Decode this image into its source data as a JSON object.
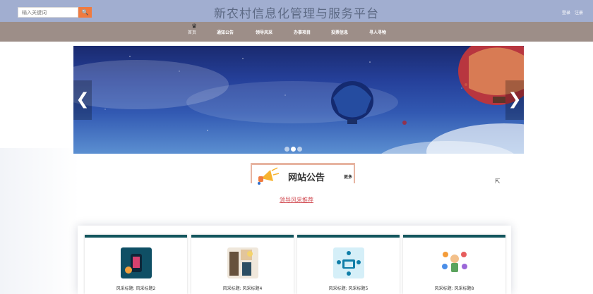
{
  "header": {
    "search_placeholder": "输入关键词",
    "search_button_glyph": "🔍",
    "title": "新农村信息化管理与服务平台",
    "login_label": "登录",
    "register_label": "注册"
  },
  "nav": {
    "items": [
      "首页",
      "通知公告",
      "领导风采",
      "办事项目",
      "投票信息",
      "寻人寻物"
    ]
  },
  "banner": {
    "prev_glyph": "❮",
    "next_glyph": "❯"
  },
  "notice": {
    "title": "网站公告",
    "more_label": "更多"
  },
  "leaders": {
    "section_title": "领导风采推荐",
    "cards": [
      {
        "caption": "风采标题: 风采标题2"
      },
      {
        "caption": "风采标题: 风采标题4"
      },
      {
        "caption": "风采标题: 风采标题5"
      },
      {
        "caption": "风采标题: 风采标题8"
      }
    ]
  },
  "colors": {
    "topbar": "#a1aed0",
    "navbar": "#9d8e88",
    "accent_orange": "#f07b3f",
    "card_border": "#13565e",
    "section_title": "#d24d54"
  }
}
